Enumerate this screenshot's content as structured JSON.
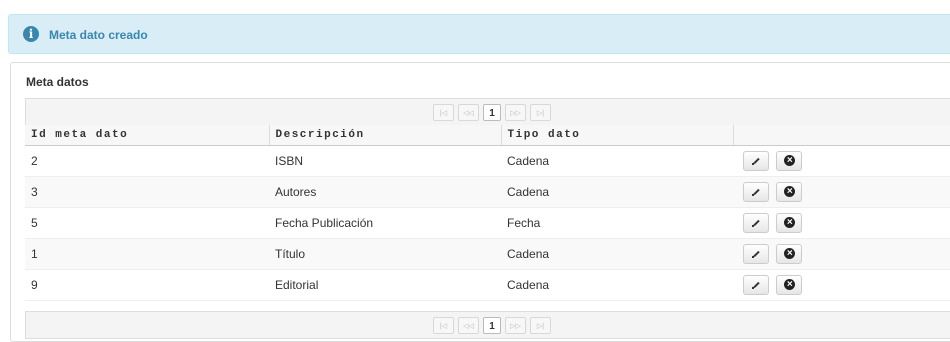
{
  "alert": {
    "message": "Meta dato creado",
    "icon": "i"
  },
  "panel": {
    "title": "Meta datos"
  },
  "pager": {
    "first": "|◁",
    "prev": "◁◁",
    "current": "1",
    "next": "▷▷",
    "last": "▷|"
  },
  "table": {
    "headers": [
      "Id meta dato",
      "Descripción",
      "Tipo dato",
      ""
    ],
    "rows": [
      {
        "id": "2",
        "descripcion": "ISBN",
        "tipo": "Cadena"
      },
      {
        "id": "3",
        "descripcion": "Autores",
        "tipo": "Cadena"
      },
      {
        "id": "5",
        "descripcion": "Fecha Publicación",
        "tipo": "Fecha"
      },
      {
        "id": "1",
        "descripcion": "Título",
        "tipo": "Cadena"
      },
      {
        "id": "9",
        "descripcion": "Editorial",
        "tipo": "Cadena"
      }
    ]
  },
  "colors": {
    "info": "#3a87ad",
    "info_bg": "#d9edf7"
  }
}
